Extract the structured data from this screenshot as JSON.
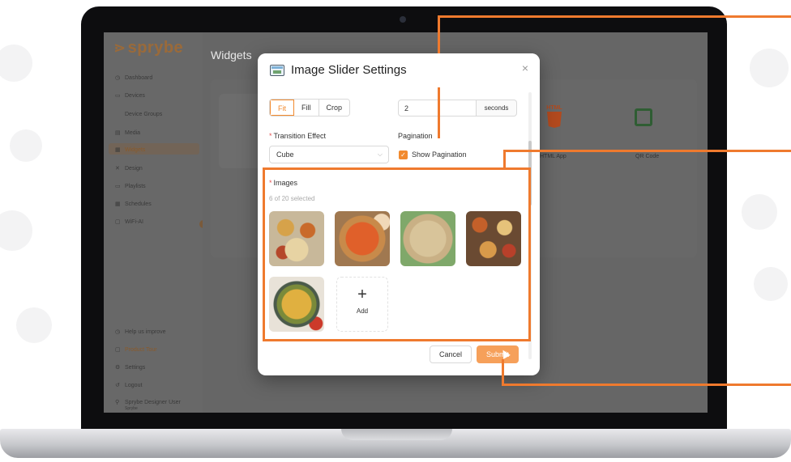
{
  "app": {
    "brand": "sprybe",
    "page_title": "Widgets",
    "sidebar": [
      {
        "icon": "dashboard-icon",
        "glyph": "◷",
        "label": "Dashboard"
      },
      {
        "icon": "devices-icon",
        "glyph": "▭",
        "label": "Devices"
      },
      {
        "icon": "",
        "glyph": "",
        "label": "Device Groups"
      },
      {
        "icon": "media-icon",
        "glyph": "▤",
        "label": "Media"
      },
      {
        "icon": "widgets-icon",
        "glyph": "▦",
        "label": "Widgets"
      },
      {
        "icon": "design-icon",
        "glyph": "✕",
        "label": "Design"
      },
      {
        "icon": "playlist-icon",
        "glyph": "▭",
        "label": "Playlists"
      },
      {
        "icon": "schedule-icon",
        "glyph": "▦",
        "label": "Schedules"
      },
      {
        "icon": "ai-icon",
        "glyph": "▢",
        "label": "WiFi-AI"
      }
    ],
    "sidebar_bottom": [
      {
        "icon": "help-icon",
        "glyph": "◷",
        "label": "Help us improve"
      },
      {
        "icon": "tour-icon",
        "glyph": "▢",
        "label": "Product Tour"
      },
      {
        "icon": "settings-icon",
        "glyph": "⚙",
        "label": "Settings"
      },
      {
        "icon": "logout-icon",
        "glyph": "↺",
        "label": "Logout"
      }
    ],
    "user": {
      "name": "Sprybe Designer User",
      "sub": "Sprybe"
    },
    "widgets": [
      {
        "label": "HTML App",
        "badge": "HTML"
      },
      {
        "label": "QR Code"
      }
    ]
  },
  "modal": {
    "title": "Image Slider Settings",
    "close": "×",
    "content_fit": {
      "options": [
        "Fit",
        "Fill",
        "Crop"
      ],
      "selected": "Fit"
    },
    "duration": {
      "value": "2",
      "unit": "seconds"
    },
    "transition": {
      "label": "Transition Effect",
      "value": "Cube"
    },
    "pagination": {
      "label": "Pagination",
      "checkbox_label": "Show Pagination",
      "checked": true
    },
    "images": {
      "label": "Images",
      "count": "6 of 20 selected",
      "add_label": "Add"
    },
    "buttons": {
      "cancel": "Cancel",
      "submit": "Submit"
    }
  },
  "colors": {
    "accent": "#f28a2e",
    "callout": "#ef7a2e",
    "submit_bg": "#f6a05a"
  }
}
